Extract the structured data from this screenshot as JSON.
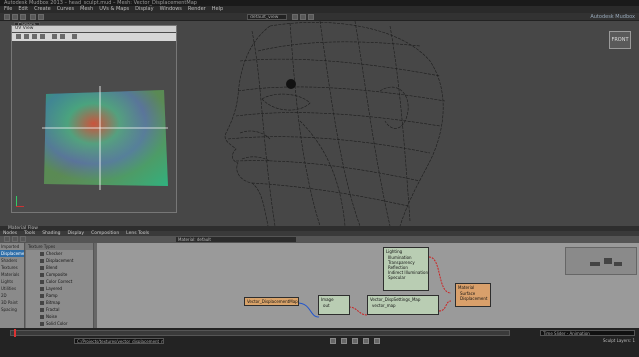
{
  "titlebar": {
    "text": "Autodesk Mudbox 2013 – head_sculpt.mud – Mesh: Vector_DisplacementMap"
  },
  "menubar": {
    "items": [
      "File",
      "Edit",
      "Create",
      "Curves",
      "Mesh",
      "UVs & Maps",
      "Display",
      "Windows",
      "Render",
      "Help"
    ]
  },
  "toolbar": {
    "camera_field": "default_view",
    "brand": "Autodesk Mudbox"
  },
  "viewport": {
    "camera_label": "Camera",
    "cube_label": "FRONT"
  },
  "uv_panel": {
    "title": "UV View"
  },
  "graph": {
    "title": "Material Flow",
    "menu": [
      "Nodes",
      "Tools",
      "Shading",
      "Display",
      "Composition",
      "Lens Tools"
    ],
    "path": "Material: default",
    "categories": [
      "Imported",
      "Displacements",
      "Shaders",
      "Textures",
      "Materials",
      "Lights",
      "Utilities",
      "2D",
      "3D Paint",
      "Spacing"
    ],
    "library_header": "Texture Types",
    "library_items": [
      "Checker",
      "Displacement",
      "Blend",
      "Composite",
      "Color Correct",
      "Layered",
      "Ramp",
      "Bitmap",
      "Fractal",
      "Noise",
      "Solid Color",
      "Gradient",
      "Procedural"
    ],
    "nodes": {
      "lighting": {
        "title": "Lighting",
        "props": [
          "Illumination",
          "Transparency",
          "Reflection",
          "Indirect Illumination",
          "Specular"
        ]
      },
      "material": {
        "title": "Material",
        "props": [
          "Surface",
          "Displacement"
        ]
      },
      "texture": {
        "title": "Vector_DisplacementMap"
      },
      "image": {
        "title": "Image",
        "props": [
          "out"
        ]
      },
      "displacement": {
        "title": "Vector_DispSettings_Map",
        "props": [
          "vector_map"
        ]
      }
    }
  },
  "timeline": {
    "path": "C:/Projects/textures/vector_displacement_map.exr",
    "right_label": "Time Slider - Animation",
    "status": "Sculpt Layers: 1"
  },
  "colors": {
    "node_orange": "#d9a36a",
    "node_green": "#b9cdb3",
    "node_material": "#d9a06b",
    "wire_red": "#cc2222",
    "wire_blue": "#2255cc"
  }
}
